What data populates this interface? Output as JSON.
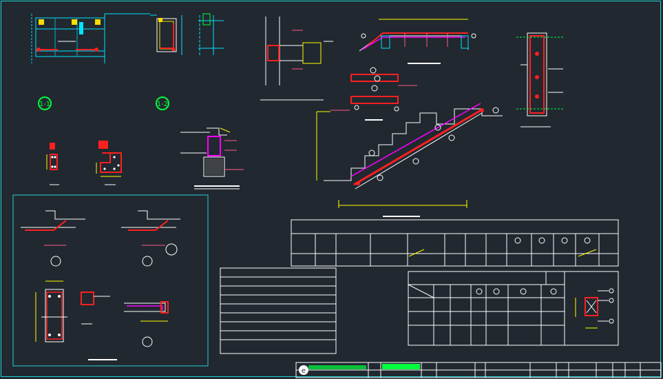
{
  "drawing": {
    "background": "#212830",
    "colors": {
      "border": "#1fd4d4",
      "line": "#ffffff",
      "cyan": "#00e5ff",
      "rebar": "#ff2020",
      "pink": "#ff5c8a",
      "yellow": "#ffff00",
      "green": "#00ff3c",
      "magenta": "#ff00ff",
      "dim": "#c8c800"
    },
    "section_markers": [
      {
        "label": "1-1"
      },
      {
        "label": "1-2"
      }
    ],
    "title_block": {
      "logo_text": "e",
      "green_tag": "",
      "cells": [
        "",
        "",
        "",
        "",
        ""
      ]
    }
  }
}
